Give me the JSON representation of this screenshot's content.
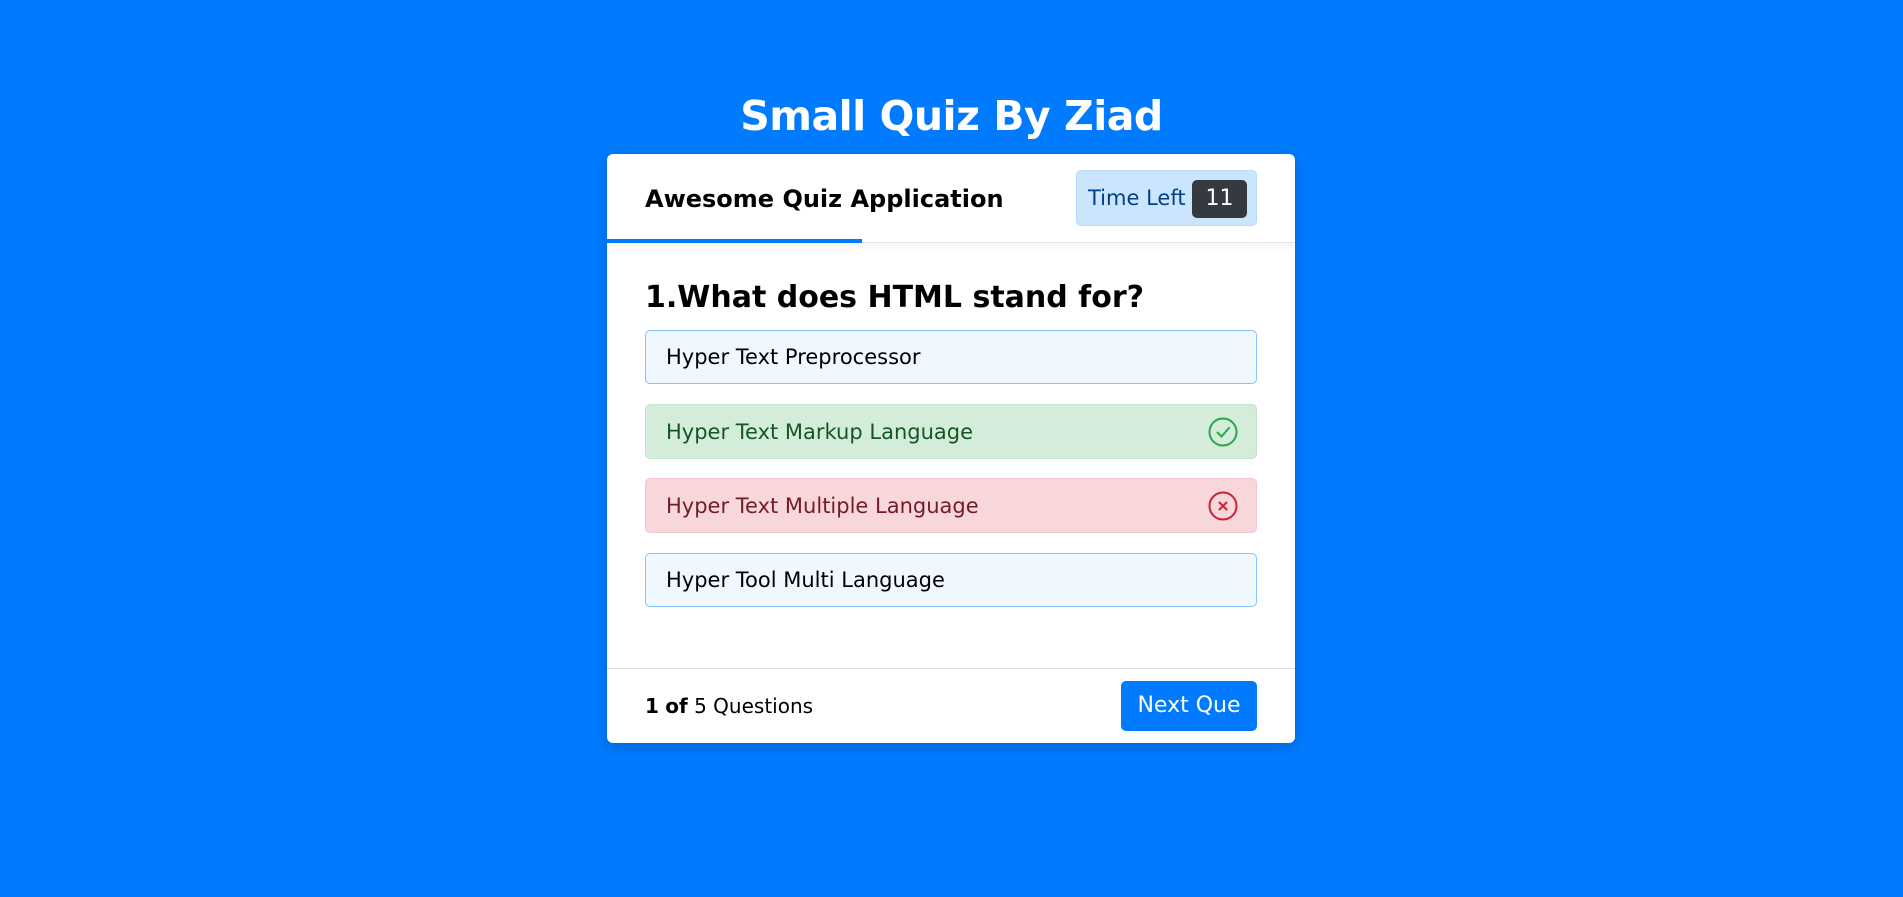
{
  "page": {
    "title": "Small Quiz By Ziad"
  },
  "header": {
    "app_title": "Awesome Quiz Application",
    "timer_label": "Time Left",
    "timer_value": "11",
    "time_progress_fraction": 0.37
  },
  "question": {
    "text": "1.What does HTML stand for?",
    "options": [
      {
        "label": "Hyper Text Preprocessor",
        "state": "neutral"
      },
      {
        "label": "Hyper Text Markup Language",
        "state": "correct",
        "icon": "check-circle-icon"
      },
      {
        "label": "Hyper Text Multiple Language",
        "state": "incorrect",
        "icon": "x-circle-icon"
      },
      {
        "label": "Hyper Tool Multi Language",
        "state": "neutral"
      }
    ]
  },
  "footer": {
    "current": "1",
    "of_label": "of",
    "total_label": "5 Questions",
    "next_label": "Next Que"
  },
  "colors": {
    "background": "#007bff",
    "accent": "#007bff",
    "correct_text": "#155724",
    "incorrect_text": "#721c24",
    "timer_badge": "#343a40"
  }
}
